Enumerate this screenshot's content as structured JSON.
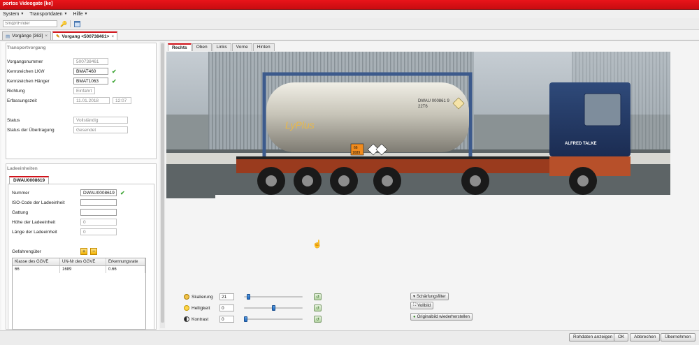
{
  "window": {
    "title": "portos Videogate [ke]"
  },
  "menu": [
    {
      "label": "System"
    },
    {
      "label": "Transportdaten"
    },
    {
      "label": "Hilfe"
    }
  ],
  "toolbar": {
    "search_placeholder": "Sm@rtFinder"
  },
  "tabs": [
    {
      "label": "Vorgänge [363]",
      "close": "×"
    },
    {
      "label": "Vorgang <500738461>",
      "close": "×"
    }
  ],
  "transport": {
    "title": "Transportvorgang",
    "vorgangsnummer_label": "Vorgangsnummer",
    "vorgangsnummer": "500738461",
    "lkw_label": "Kennzeichen LKW",
    "lkw": "BMAT460",
    "haenger_label": "Kennzeichen Hänger",
    "haenger": "BMAT1063",
    "richtung_label": "Richtung",
    "richtung": "Einfahrt",
    "erfassungszeit_label": "Erfassungszeit",
    "datum": "11.01.2018",
    "zeit": "12:07",
    "status_label": "Status",
    "status": "Vollständig",
    "uebertragung_label": "Status der Übertragung",
    "uebertragung": "Gesendet"
  },
  "ladeeinheiten": {
    "title": "Ladeeinheiten",
    "tab": "DWAU0008619",
    "nummer_label": "Nummer",
    "nummer": "DWAU0008619",
    "iso_label": "ISO-Code der Ladeeinheit",
    "iso": "",
    "gattung_label": "Gattung",
    "gattung": "",
    "hoehe_label": "Höhe der Ladeeinheit",
    "hoehe": "0",
    "laenge_label": "Länge der Ladeeinheit",
    "laenge": "0",
    "gefahr_label": "Gefahrengüter",
    "columns": [
      "Klasse des GGVE",
      "UN-Nr des GGVE",
      "Erkennungsrate"
    ],
    "rows": [
      [
        "66",
        "1689",
        "0.66"
      ]
    ]
  },
  "view_tabs": [
    "Rechts",
    "Oben",
    "Links",
    "Vorne",
    "Hinten"
  ],
  "image": {
    "container_text": "DWAU 000861 9",
    "container_code": "22T6",
    "hazard_top": "66",
    "hazard_bottom": "1689",
    "brand": "ALFRED TALKE"
  },
  "controls": {
    "skalierung_label": "Skalierung",
    "skalierung": "21",
    "helligkeit_label": "Helligkeit",
    "helligkeit": "0",
    "kontrast_label": "Kontrast",
    "kontrast": "0",
    "skalierung_level": 0.05,
    "helligkeit_level": 0.5,
    "kontrast_level": 0.0
  },
  "filters": {
    "schaerfung": "Schärfungsfilter",
    "vollbild": "Vollbild",
    "original": "Originalbild wiederherstellen"
  },
  "footer": {
    "rohdaten": "Rohdaten anzeigen",
    "ok": "OK",
    "abbrechen": "Abbrechen",
    "uebernehmen": "Übernehmen"
  }
}
